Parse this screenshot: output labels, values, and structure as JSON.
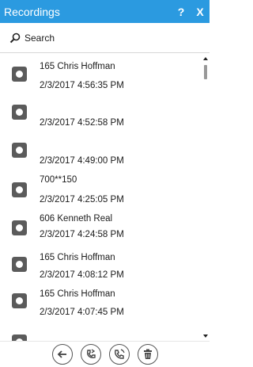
{
  "window": {
    "title": "Recordings",
    "help_label": "?",
    "close_label": "X"
  },
  "search": {
    "label": "Search"
  },
  "recordings": [
    {
      "name": "165 Chris Hoffman",
      "time": "2/3/2017 4:56:35 PM"
    },
    {
      "name": "",
      "time": "2/3/2017 4:52:58 PM"
    },
    {
      "name": "",
      "time": "2/3/2017 4:49:00 PM"
    },
    {
      "name": "700**150",
      "time": "2/3/2017 4:25:05 PM"
    },
    {
      "name": "606 Kenneth Real",
      "time": "2/3/2017 4:24:58 PM"
    },
    {
      "name": "165 Chris Hoffman",
      "time": "2/3/2017 4:08:12 PM"
    },
    {
      "name": "165 Chris Hoffman",
      "time": "2/3/2017 4:07:45 PM"
    },
    {
      "name": "",
      "time": ""
    }
  ],
  "toolbar": {
    "buttons": [
      {
        "icon": "back-arrow-icon"
      },
      {
        "icon": "phone-transfer-icon"
      },
      {
        "icon": "phone-call-icon"
      },
      {
        "icon": "trash-icon"
      }
    ]
  }
}
